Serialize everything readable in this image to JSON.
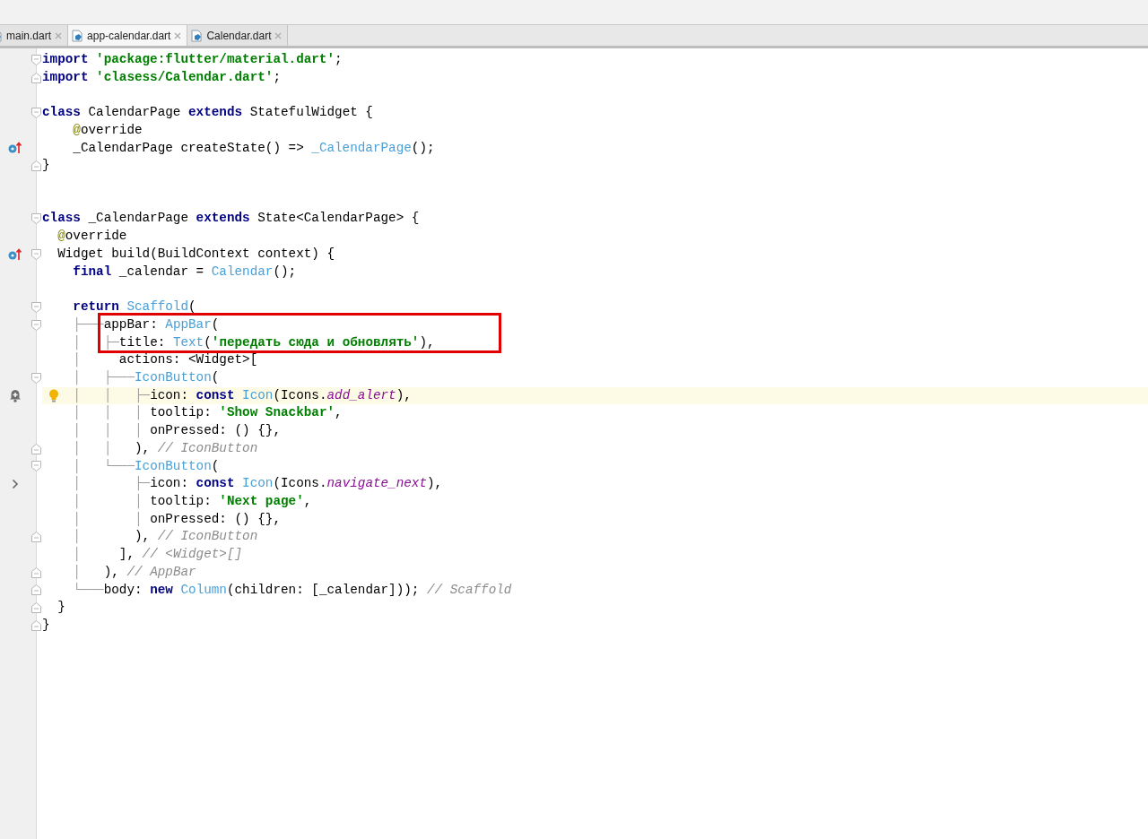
{
  "tabs": [
    {
      "label": "main.dart",
      "selected": false
    },
    {
      "label": "app-calendar.dart",
      "selected": true
    },
    {
      "label": "Calendar.dart",
      "selected": false
    }
  ],
  "lines": [
    {
      "kind": "code",
      "fold": {
        "kind": "start"
      },
      "tokens": [
        {
          "kind": "kw",
          "text": "import"
        },
        {
          "kind": "str",
          "text": " 'package:flutter/material.dart'"
        },
        {
          "kind": "plain",
          "text": ";"
        }
      ]
    },
    {
      "kind": "code",
      "fold": {
        "kind": "end"
      },
      "tokens": [
        {
          "kind": "kw",
          "text": "import"
        },
        {
          "kind": "str",
          "text": " 'clasess/Calendar.dart'"
        },
        {
          "kind": "plain",
          "text": ";"
        }
      ]
    },
    {
      "kind": "blank"
    },
    {
      "kind": "code",
      "fold": {
        "kind": "start"
      },
      "tokens": [
        {
          "kind": "kw",
          "text": "class"
        },
        {
          "kind": "plain",
          "text": " CalendarPage "
        },
        {
          "kind": "kw",
          "text": "extends"
        },
        {
          "kind": "plain",
          "text": " StatefulWidget {"
        }
      ]
    },
    {
      "kind": "code",
      "tokens": [
        {
          "kind": "ann",
          "text": "    @"
        },
        {
          "kind": "plain",
          "text": "override"
        }
      ]
    },
    {
      "kind": "code",
      "gutter": {
        "kind": "implements"
      },
      "tokens": [
        {
          "kind": "plain",
          "text": "    _CalendarPage createState() => "
        },
        {
          "kind": "type",
          "text": "_CalendarPage"
        },
        {
          "kind": "plain",
          "text": "();"
        }
      ]
    },
    {
      "kind": "code",
      "fold": {
        "kind": "end"
      },
      "tokens": [
        {
          "kind": "plain",
          "text": "}"
        }
      ]
    },
    {
      "kind": "blank"
    },
    {
      "kind": "blank"
    },
    {
      "kind": "code",
      "fold": {
        "kind": "start"
      },
      "tokens": [
        {
          "kind": "kw",
          "text": "class"
        },
        {
          "kind": "plain",
          "text": " _CalendarPage "
        },
        {
          "kind": "kw",
          "text": "extends"
        },
        {
          "kind": "plain",
          "text": " State<CalendarPage> {"
        }
      ]
    },
    {
      "kind": "code",
      "tokens": [
        {
          "kind": "ann",
          "text": "  @"
        },
        {
          "kind": "plain",
          "text": "override"
        }
      ]
    },
    {
      "kind": "code",
      "gutter": {
        "kind": "implements"
      },
      "fold": {
        "kind": "start"
      },
      "tokens": [
        {
          "kind": "plain",
          "text": "  Widget build(BuildContext context) {"
        }
      ]
    },
    {
      "kind": "code",
      "tokens": [
        {
          "kind": "kw",
          "text": "    final"
        },
        {
          "kind": "plain",
          "text": " _calendar = "
        },
        {
          "kind": "type",
          "text": "Calendar"
        },
        {
          "kind": "plain",
          "text": "();"
        }
      ]
    },
    {
      "kind": "blank"
    },
    {
      "kind": "code",
      "fold": {
        "kind": "start"
      },
      "tokens": [
        {
          "kind": "kw",
          "text": "    return"
        },
        {
          "kind": "type",
          "text": " Scaffold"
        },
        {
          "kind": "plain",
          "text": "("
        }
      ]
    },
    {
      "kind": "code",
      "fold": {
        "kind": "start"
      },
      "boxed": true,
      "tokens": [
        {
          "kind": "guide",
          "text": "    ├───"
        },
        {
          "kind": "plain",
          "text": "appBar: "
        },
        {
          "kind": "type",
          "text": "AppBar"
        },
        {
          "kind": "plain",
          "text": "("
        }
      ]
    },
    {
      "kind": "code",
      "boxed": true,
      "tokens": [
        {
          "kind": "guide",
          "text": "    │   ├─"
        },
        {
          "kind": "plain",
          "text": "title: "
        },
        {
          "kind": "type",
          "text": "Text"
        },
        {
          "kind": "plain",
          "text": "("
        },
        {
          "kind": "str",
          "text": "'передать сюда и обновлять'"
        },
        {
          "kind": "plain",
          "text": "),"
        }
      ]
    },
    {
      "kind": "code",
      "tokens": [
        {
          "kind": "guide",
          "text": "    │     "
        },
        {
          "kind": "plain",
          "text": "actions: <Widget>["
        }
      ]
    },
    {
      "kind": "code",
      "fold": {
        "kind": "start"
      },
      "tokens": [
        {
          "kind": "guide",
          "text": "    │   ├───"
        },
        {
          "kind": "type",
          "text": "IconButton"
        },
        {
          "kind": "plain",
          "text": "("
        }
      ]
    },
    {
      "kind": "code",
      "gutter": {
        "kind": "notification"
      },
      "bulb": true,
      "highlighted": true,
      "tokens": [
        {
          "kind": "guide",
          "text": "    │   │   ├─"
        },
        {
          "kind": "plain",
          "text": "icon: "
        },
        {
          "kind": "kw",
          "text": "const"
        },
        {
          "kind": "type",
          "text": " Icon"
        },
        {
          "kind": "plain",
          "text": "(Icons."
        },
        {
          "kind": "member",
          "text": "add_alert"
        },
        {
          "kind": "plain",
          "text": "),"
        }
      ]
    },
    {
      "kind": "code",
      "tokens": [
        {
          "kind": "guide",
          "text": "    │   │   │ "
        },
        {
          "kind": "plain",
          "text": "tooltip: "
        },
        {
          "kind": "str",
          "text": "'Show Snackbar'"
        },
        {
          "kind": "plain",
          "text": ","
        }
      ]
    },
    {
      "kind": "code",
      "tokens": [
        {
          "kind": "guide",
          "text": "    │   │   │ "
        },
        {
          "kind": "plain",
          "text": "onPressed: () {},"
        }
      ]
    },
    {
      "kind": "code",
      "fold": {
        "kind": "end"
      },
      "tokens": [
        {
          "kind": "guide",
          "text": "    │   │   "
        },
        {
          "kind": "plain",
          "text": "), "
        },
        {
          "kind": "comment",
          "text": "// IconButton"
        }
      ]
    },
    {
      "kind": "code",
      "fold": {
        "kind": "start"
      },
      "tokens": [
        {
          "kind": "guide",
          "text": "    │   └───"
        },
        {
          "kind": "type",
          "text": "IconButton"
        },
        {
          "kind": "plain",
          "text": "("
        }
      ]
    },
    {
      "kind": "code",
      "gutter": {
        "kind": "expand"
      },
      "tokens": [
        {
          "kind": "guide",
          "text": "    │       ├─"
        },
        {
          "kind": "plain",
          "text": "icon: "
        },
        {
          "kind": "kw",
          "text": "const"
        },
        {
          "kind": "type",
          "text": " Icon"
        },
        {
          "kind": "plain",
          "text": "(Icons."
        },
        {
          "kind": "member",
          "text": "navigate_next"
        },
        {
          "kind": "plain",
          "text": "),"
        }
      ]
    },
    {
      "kind": "code",
      "tokens": [
        {
          "kind": "guide",
          "text": "    │       │ "
        },
        {
          "kind": "plain",
          "text": "tooltip: "
        },
        {
          "kind": "str",
          "text": "'Next page'"
        },
        {
          "kind": "plain",
          "text": ","
        }
      ]
    },
    {
      "kind": "code",
      "tokens": [
        {
          "kind": "guide",
          "text": "    │       │ "
        },
        {
          "kind": "plain",
          "text": "onPressed: () {},"
        }
      ]
    },
    {
      "kind": "code",
      "fold": {
        "kind": "end"
      },
      "tokens": [
        {
          "kind": "guide",
          "text": "    │       "
        },
        {
          "kind": "plain",
          "text": "), "
        },
        {
          "kind": "comment",
          "text": "// IconButton"
        }
      ]
    },
    {
      "kind": "code",
      "tokens": [
        {
          "kind": "guide",
          "text": "    │     "
        },
        {
          "kind": "plain",
          "text": "], "
        },
        {
          "kind": "comment",
          "text": "// <Widget>[]"
        }
      ]
    },
    {
      "kind": "code",
      "fold": {
        "kind": "end"
      },
      "tokens": [
        {
          "kind": "guide",
          "text": "    │   "
        },
        {
          "kind": "plain",
          "text": "), "
        },
        {
          "kind": "comment",
          "text": "// AppBar"
        }
      ]
    },
    {
      "kind": "code",
      "fold": {
        "kind": "end"
      },
      "tokens": [
        {
          "kind": "guide",
          "text": "    └───"
        },
        {
          "kind": "plain",
          "text": "body: "
        },
        {
          "kind": "kw",
          "text": "new"
        },
        {
          "kind": "type",
          "text": " Column"
        },
        {
          "kind": "plain",
          "text": "(children: [_calendar])); "
        },
        {
          "kind": "comment",
          "text": "// Scaffold"
        }
      ]
    },
    {
      "kind": "code",
      "fold": {
        "kind": "end"
      },
      "tokens": [
        {
          "kind": "plain",
          "text": "  }"
        }
      ]
    },
    {
      "kind": "code",
      "fold": {
        "kind": "end"
      },
      "tokens": [
        {
          "kind": "plain",
          "text": "}"
        }
      ]
    }
  ]
}
